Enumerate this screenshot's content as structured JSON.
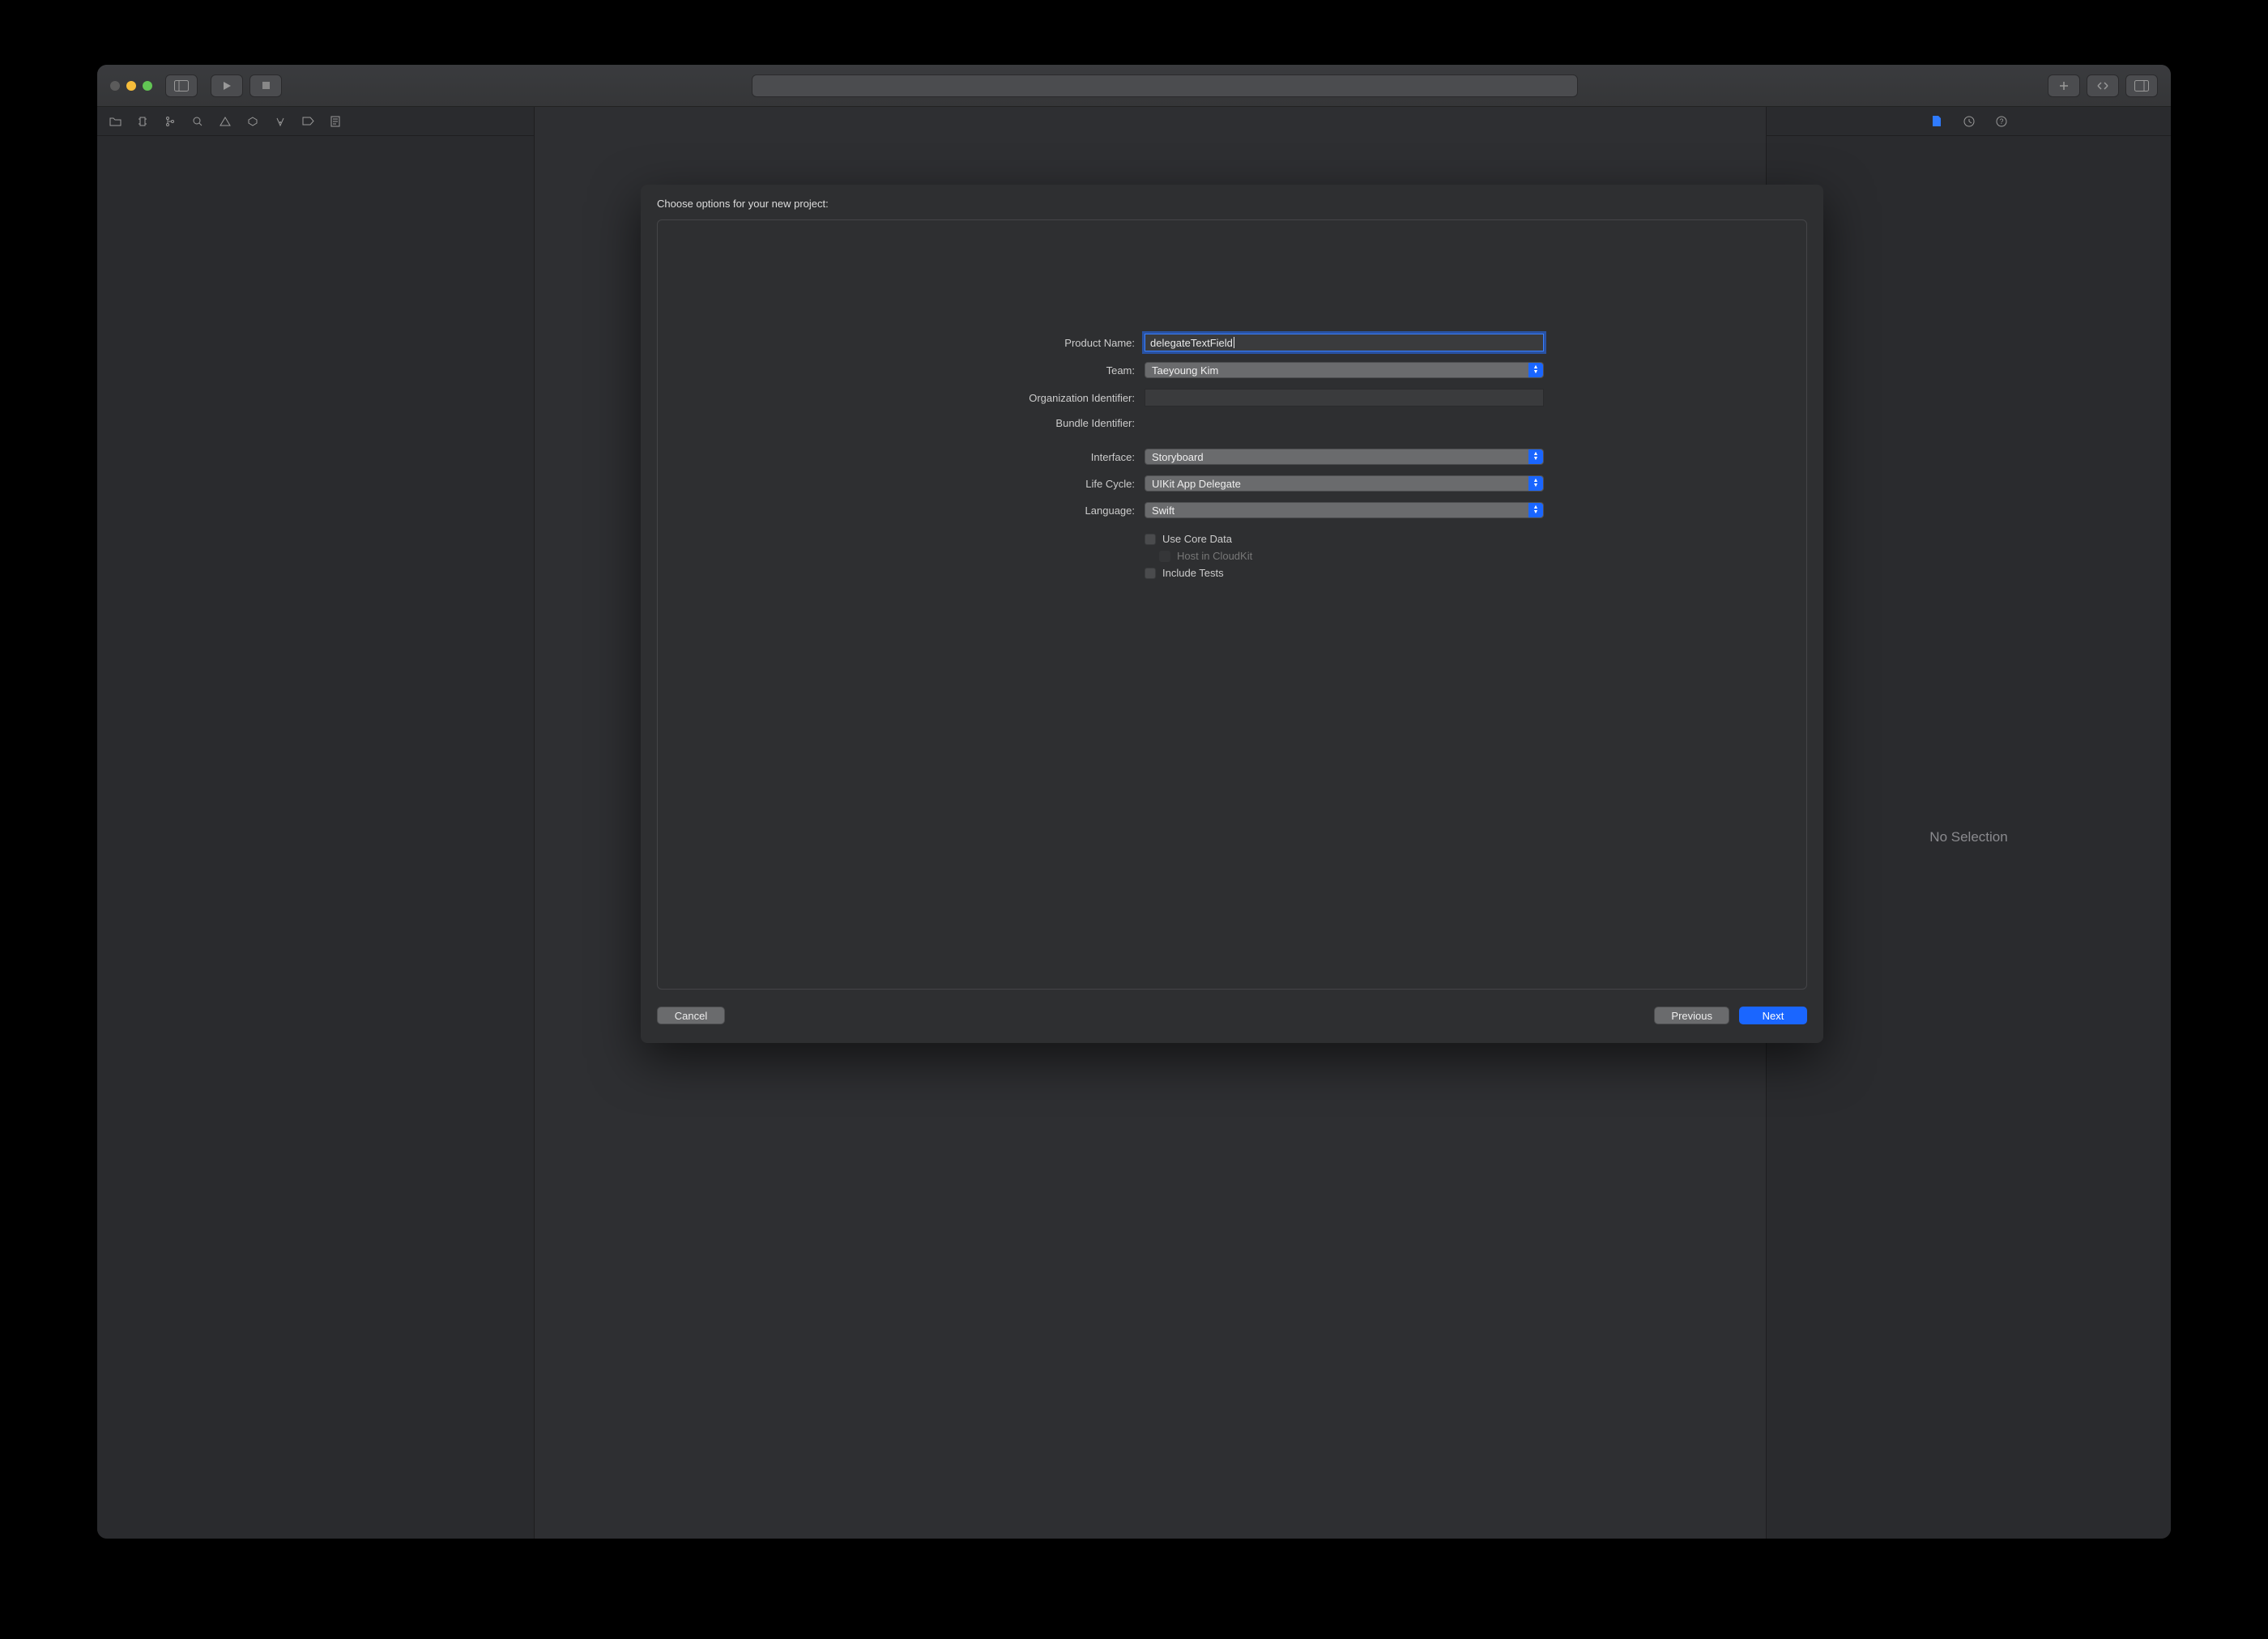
{
  "sheet": {
    "title": "Choose options for your new project:",
    "labels": {
      "product": "Product Name:",
      "team": "Team:",
      "org": "Organization Identifier:",
      "bundle": "Bundle Identifier:",
      "interface": "Interface:",
      "lifecycle": "Life Cycle:",
      "language": "Language:"
    },
    "values": {
      "product": "delegateTextField",
      "team": "Taeyoung Kim",
      "org": "",
      "bundle": "",
      "interface": "Storyboard",
      "lifecycle": "UIKit App Delegate",
      "language": "Swift"
    },
    "checkboxes": {
      "coredata": "Use Core Data",
      "cloudkit": "Host in CloudKit",
      "tests": "Include Tests"
    },
    "buttons": {
      "cancel": "Cancel",
      "previous": "Previous",
      "next": "Next"
    }
  },
  "inspector": {
    "noSelection": "No Selection"
  }
}
